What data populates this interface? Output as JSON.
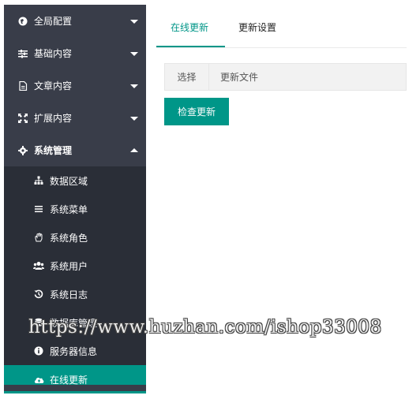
{
  "sidebar": {
    "items": [
      {
        "label": "全局配置",
        "icon": "globe-icon"
      },
      {
        "label": "基础内容",
        "icon": "sliders-icon"
      },
      {
        "label": "文章内容",
        "icon": "document-icon"
      },
      {
        "label": "扩展内容",
        "icon": "expand-icon"
      },
      {
        "label": "系统管理",
        "icon": "gear-icon"
      }
    ],
    "submenu": [
      {
        "label": "数据区域",
        "icon": "sitemap-icon"
      },
      {
        "label": "系统菜单",
        "icon": "list-icon"
      },
      {
        "label": "系统角色",
        "icon": "hand-icon"
      },
      {
        "label": "系统用户",
        "icon": "users-icon"
      },
      {
        "label": "系统日志",
        "icon": "history-icon"
      },
      {
        "label": "数据库管理",
        "icon": "database-icon"
      },
      {
        "label": "服务器信息",
        "icon": "info-icon"
      },
      {
        "label": "在线更新",
        "icon": "cloud-upload-icon"
      }
    ]
  },
  "tabs": [
    {
      "label": "在线更新"
    },
    {
      "label": "更新设置"
    }
  ],
  "upload": {
    "choose_label": "选择",
    "file_label": "更新文件"
  },
  "check_button": "检查更新",
  "watermark": "https://www.huzhan.com/ishop33008",
  "colors": {
    "sidebar_bg": "#393d49",
    "submenu_bg": "#2a2e37",
    "accent": "#009688"
  }
}
